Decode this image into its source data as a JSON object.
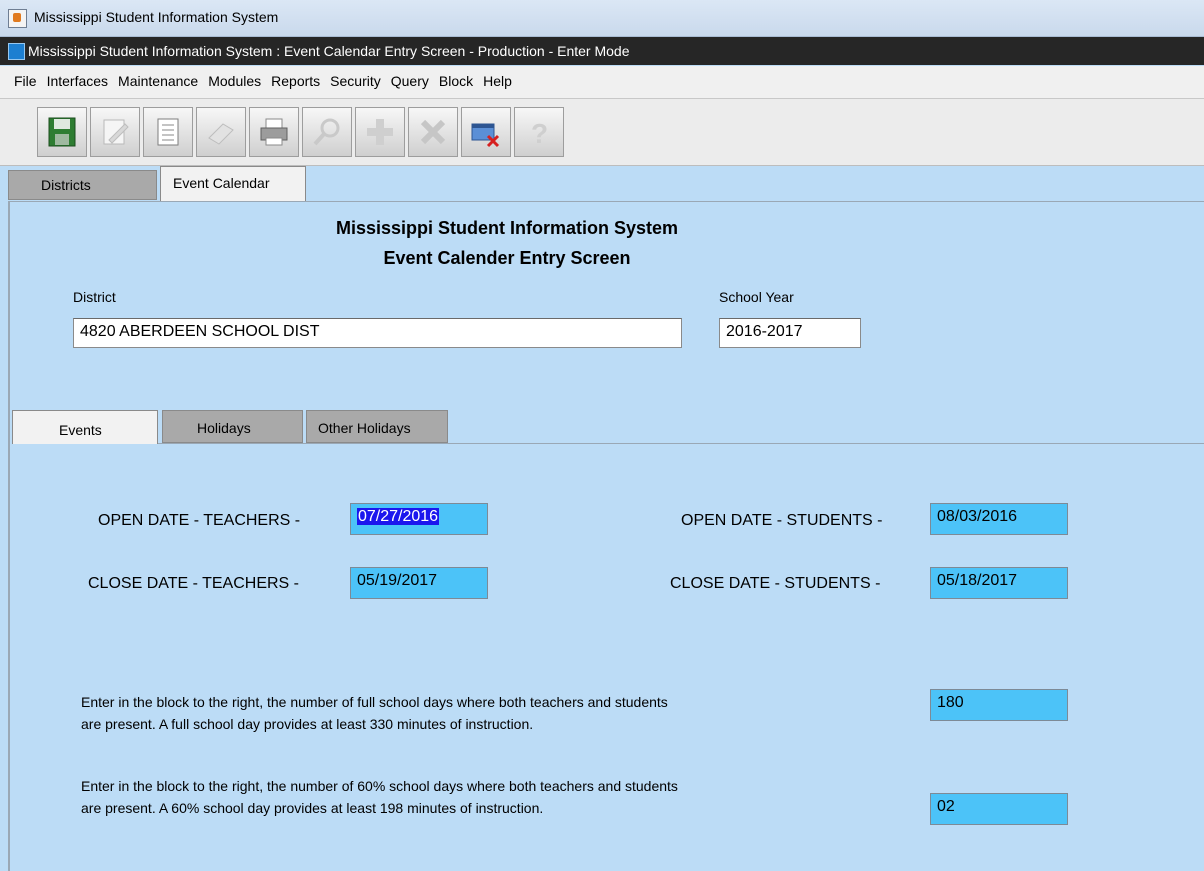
{
  "window": {
    "title": "Mississippi Student Information System"
  },
  "form": {
    "title": "Mississippi Student Information System : Event Calendar Entry Screen  -  Production  -  Enter Mode"
  },
  "menu": [
    "File",
    "Interfaces",
    "Maintenance",
    "Modules",
    "Reports",
    "Security",
    "Query",
    "Block",
    "Help"
  ],
  "toolbar": [
    "save-icon",
    "edit-icon",
    "document-icon",
    "eraser-icon",
    "print-icon",
    "search-icon",
    "add-icon",
    "delete-icon",
    "exit-icon",
    "help-icon"
  ],
  "tabs": {
    "districts": "Districts",
    "event_calendar": "Event Calendar"
  },
  "header": {
    "line1": "Mississippi Student Information System",
    "line2": "Event Calender Entry Screen"
  },
  "district": {
    "label": "District",
    "value": "4820 ABERDEEN SCHOOL DIST"
  },
  "school_year": {
    "label": "School Year",
    "value": "2016-2017"
  },
  "subtabs": {
    "events": "Events",
    "holidays": "Holidays",
    "other": "Other Holidays"
  },
  "events": {
    "open_teachers_label": "OPEN DATE - TEACHERS -",
    "open_teachers_value": "07/27/2016",
    "open_students_label": "OPEN DATE - STUDENTS -",
    "open_students_value": "08/03/2016",
    "close_teachers_label": "CLOSE DATE - TEACHERS -",
    "close_teachers_value": "05/19/2017",
    "close_students_label": "CLOSE DATE - STUDENTS -",
    "close_students_value": "05/18/2017",
    "full_days_line1": "Enter in the block to the right, the number of full school days where both teachers and students",
    "full_days_line2": "are present. A full school day provides at least 330 minutes of instruction.",
    "full_days_value": "180",
    "pct_days_line1": "Enter in the block to the right, the number of 60% school days where both teachers and students",
    "pct_days_line2": "are present. A 60% school day provides at least 198 minutes of instruction.",
    "pct_days_value": "02"
  }
}
